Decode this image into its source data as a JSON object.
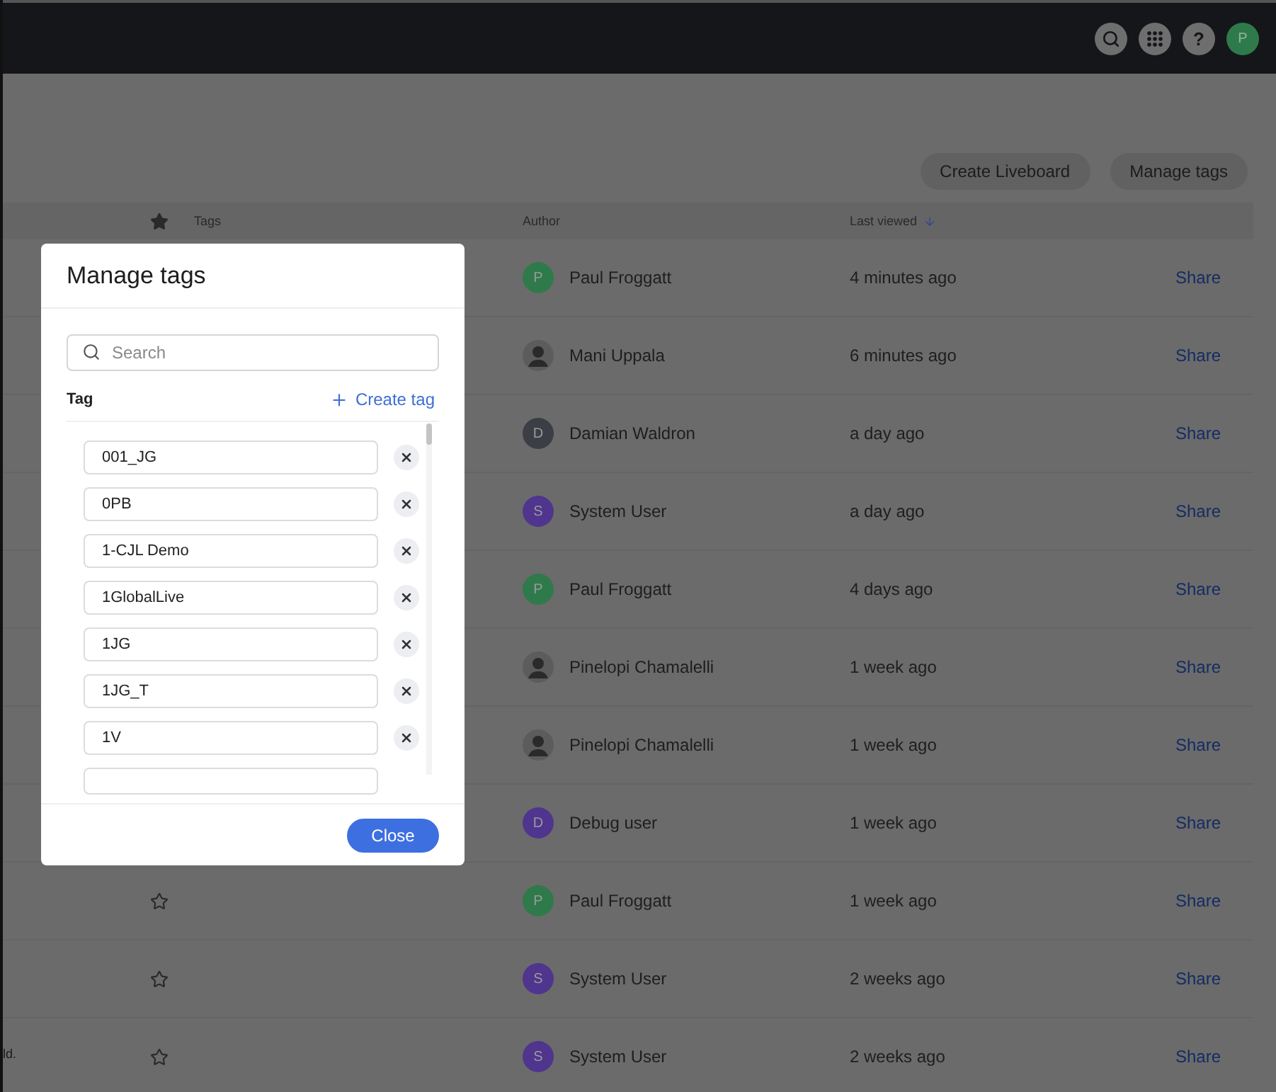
{
  "top_bar": {
    "help_label": "?",
    "user_avatar": {
      "letter": "P",
      "color": "#2f7a4b"
    }
  },
  "actions": [
    {
      "label": "Create Liveboard"
    },
    {
      "label": "Manage tags"
    }
  ],
  "table": {
    "columns": [
      {
        "label": "Tags"
      },
      {
        "label": "Author"
      },
      {
        "label": "Last viewed",
        "sorted": true
      }
    ],
    "rows": [
      {
        "author": "Paul Froggatt",
        "avatar": {
          "kind": "letter",
          "letter": "P",
          "color": "#2f7a4b"
        },
        "last_viewed": "4 minutes ago",
        "action": "Share"
      },
      {
        "author": "Mani Uppala",
        "avatar": {
          "kind": "photo"
        },
        "last_viewed": "6 minutes ago",
        "action": "Share"
      },
      {
        "author": "Damian Waldron",
        "avatar": {
          "kind": "letter",
          "letter": "D",
          "color": "#3b3e44"
        },
        "last_viewed": "a day ago",
        "action": "Share"
      },
      {
        "author": "System User",
        "avatar": {
          "kind": "letter",
          "letter": "S",
          "color": "#4f358e"
        },
        "last_viewed": "a day ago",
        "action": "Share"
      },
      {
        "author": "Paul Froggatt",
        "avatar": {
          "kind": "letter",
          "letter": "P",
          "color": "#2f7a4b"
        },
        "last_viewed": "4 days ago",
        "action": "Share"
      },
      {
        "author": "Pinelopi Chamalelli",
        "avatar": {
          "kind": "photo"
        },
        "last_viewed": "1 week ago",
        "action": "Share"
      },
      {
        "author": "Pinelopi Chamalelli",
        "avatar": {
          "kind": "photo"
        },
        "last_viewed": "1 week ago",
        "action": "Share"
      },
      {
        "author": "Debug user",
        "avatar": {
          "kind": "letter",
          "letter": "D",
          "color": "#4f358e"
        },
        "last_viewed": "1 week ago",
        "action": "Share"
      },
      {
        "starred": false,
        "author": "Paul Froggatt",
        "avatar": {
          "kind": "letter",
          "letter": "P",
          "color": "#2f7a4b"
        },
        "last_viewed": "1 week ago",
        "action": "Share"
      },
      {
        "starred": false,
        "author": "System User",
        "avatar": {
          "kind": "letter",
          "letter": "S",
          "color": "#4f358e"
        },
        "last_viewed": "2 weeks ago",
        "action": "Share"
      },
      {
        "starred": false,
        "author": "System User",
        "avatar": {
          "kind": "letter",
          "letter": "S",
          "color": "#4f358e"
        },
        "last_viewed": "2 weeks ago",
        "action": "Share"
      }
    ]
  },
  "footer_fragment": "ld.",
  "modal": {
    "title": "Manage tags",
    "search": {
      "placeholder": "Search"
    },
    "tag_label": "Tag",
    "create_label": "Create tag",
    "tags": [
      {
        "value": "001_JG"
      },
      {
        "value": "0PB"
      },
      {
        "value": "1-CJL Demo"
      },
      {
        "value": "1GlobalLive"
      },
      {
        "value": "1JG"
      },
      {
        "value": "1JG_T"
      },
      {
        "value": "1V"
      }
    ],
    "close_label": "Close"
  }
}
